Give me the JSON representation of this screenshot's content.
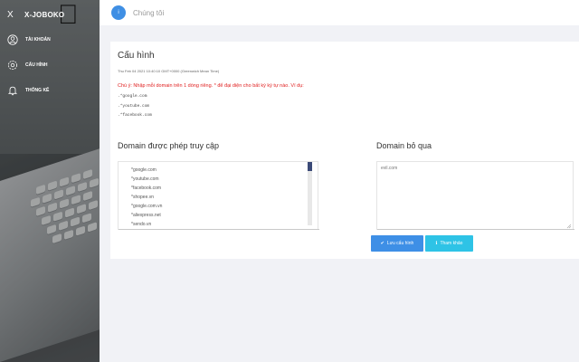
{
  "app": {
    "title": "X-JOBOKO",
    "close_label": "X"
  },
  "sidebar": {
    "items": [
      {
        "label": "Tài khoản",
        "icon": "user-icon"
      },
      {
        "label": "Cấu hình",
        "icon": "gear-icon"
      },
      {
        "label": "Thống kê",
        "icon": "bell-icon"
      }
    ]
  },
  "topbar": {
    "badge": "i",
    "title": "Chúng tôi"
  },
  "card": {
    "title": "Cấu hình",
    "timestamp": "Thu Feb 04 2021 10:40:10 GMT+0000 (Greenwich Mean Time)",
    "note": "Chú ý: Nhập mỗi domain trên 1 dòng riêng. * để đại diện cho bất kỳ ký tự nào. Ví dụ:",
    "examples": [
      ".*google.com",
      ".*youtube.com",
      ".*facebook.com"
    ]
  },
  "allowed": {
    "title": "Domain được phép truy cập",
    "domains": [
      "*google.com",
      "*youtube.com",
      "*facebook.com",
      "*shopee.vn",
      "*google.com.vn",
      "*aliexpress.net",
      "*sendo.vn"
    ]
  },
  "ignored": {
    "title": "Domain bỏ qua",
    "value": "evil.com"
  },
  "buttons": {
    "save": "Lưu cấu hình",
    "reference": "Tham khảo"
  },
  "colors": {
    "primary": "#3e8fe6",
    "info": "#2ec3e6",
    "warning_text": "#e02020"
  }
}
